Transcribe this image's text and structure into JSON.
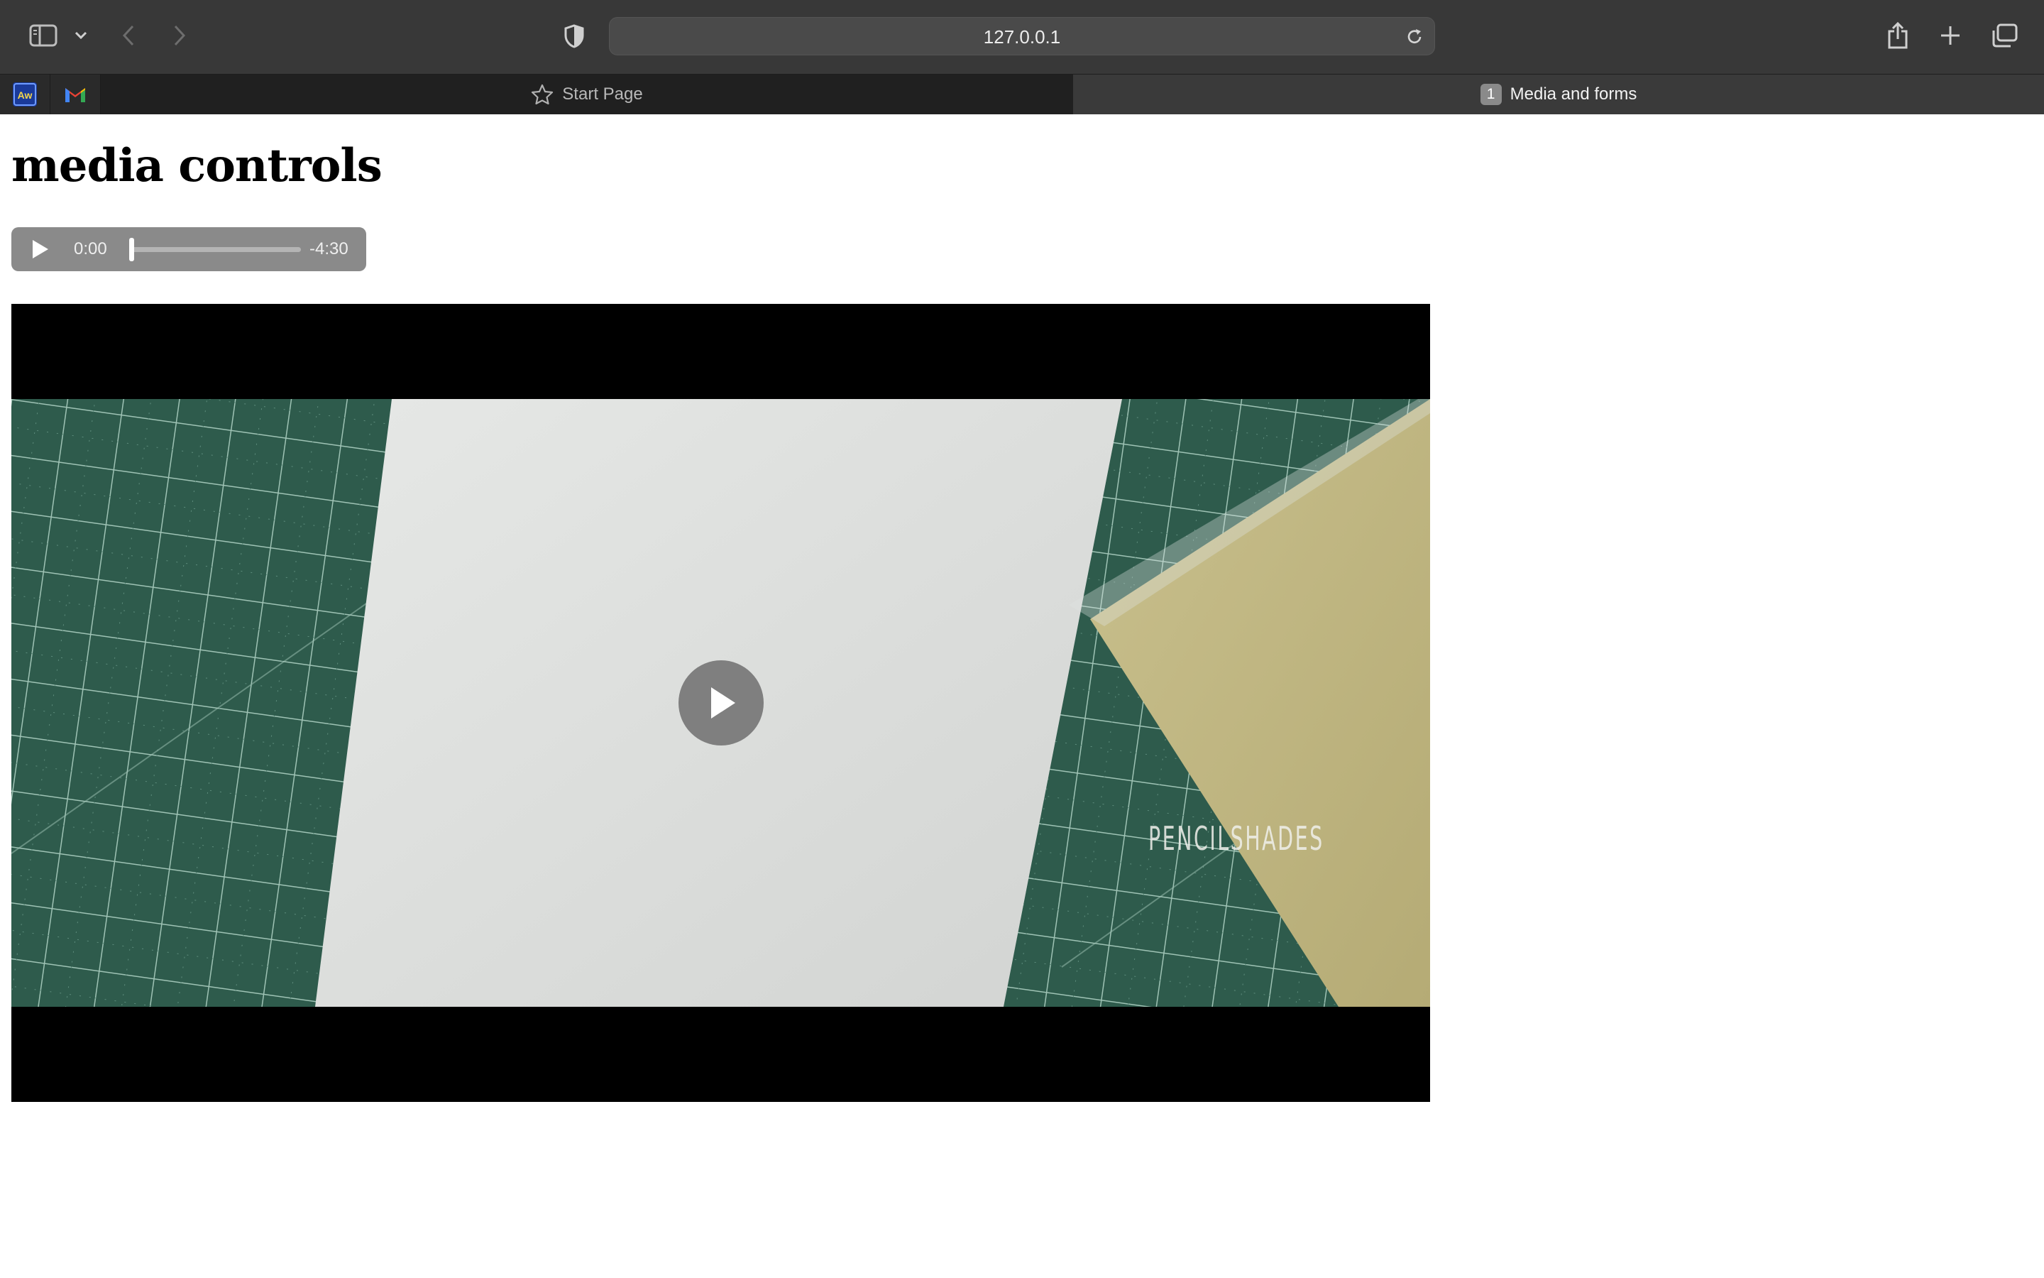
{
  "browser": {
    "url": "127.0.0.1",
    "tabs": [
      {
        "label": "Start Page",
        "active": false
      },
      {
        "label": "Media and forms",
        "active": true,
        "badge": "1"
      }
    ],
    "pinned": [
      {
        "name": "Aw",
        "icon": "adobe-aw-icon"
      },
      {
        "name": "M",
        "icon": "gmail-icon"
      }
    ]
  },
  "page": {
    "title": "media controls"
  },
  "audio": {
    "current_time": "0:00",
    "remaining_time": "-4:30",
    "progress": 0.0
  },
  "video": {
    "watermark": "PENCILSHADES",
    "state": "paused"
  },
  "colors": {
    "toolbar": "#383838",
    "grid_mat": "#2e5b4c",
    "paper": "#dcdedc",
    "kraft": "#c8bf8a"
  }
}
